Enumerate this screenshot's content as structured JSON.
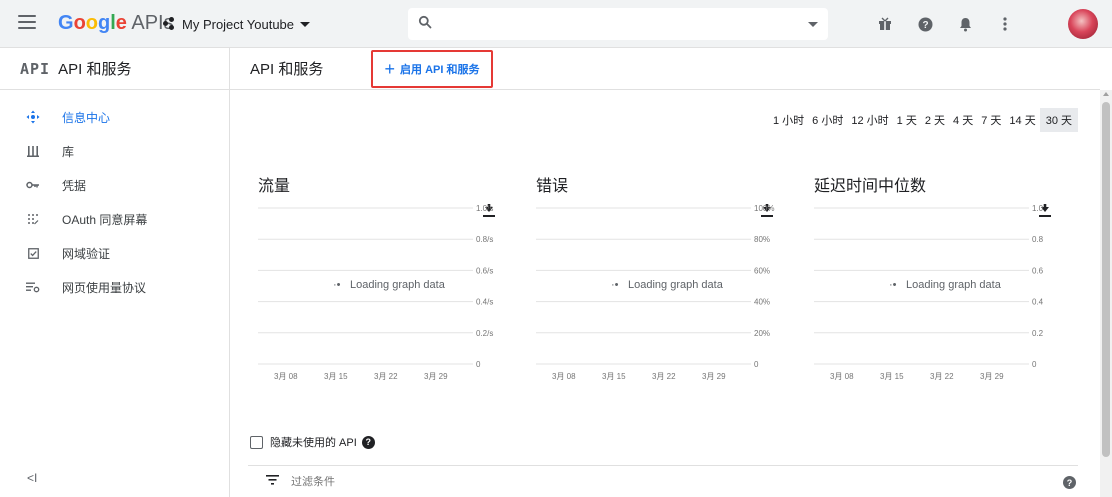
{
  "topbar": {
    "brand_google": "Google",
    "brand_suffix": " APIs",
    "project_name": "My Project Youtube",
    "search_value": "",
    "icons": [
      "gift-icon",
      "help-icon",
      "bell-icon",
      "more-vert-icon"
    ]
  },
  "colors": {
    "google_blue": "#4285F4",
    "google_red": "#EA4335",
    "google_yellow": "#FBBC05",
    "google_green": "#34A853",
    "accent": "#1a73e8",
    "highlight_border": "#e53935"
  },
  "sidebar": {
    "logo": "API",
    "title": "API 和服务",
    "items": [
      {
        "label": "信息中心",
        "icon": "dashboard-icon",
        "active": true
      },
      {
        "label": "库",
        "icon": "library-icon",
        "active": false
      },
      {
        "label": "凭据",
        "icon": "key-icon",
        "active": false
      },
      {
        "label": "OAuth 同意屏幕",
        "icon": "consent-icon",
        "active": false
      },
      {
        "label": "网域验证",
        "icon": "checkbox-icon",
        "active": false
      },
      {
        "label": "网页使用量协议",
        "icon": "settings-list-icon",
        "active": false
      }
    ],
    "collapse_label": "<I"
  },
  "main": {
    "title": "API 和服务",
    "enable_label": "启用 API 和服务",
    "time_ranges": [
      "1 小时",
      "6 小时",
      "12 小时",
      "1 天",
      "2 天",
      "4 天",
      "7 天",
      "14 天",
      "30 天"
    ],
    "selected_range": "30 天",
    "hide_unused_label": "隐藏未使用的 API",
    "filter_placeholder": "过滤条件"
  },
  "chart_data": [
    {
      "type": "line",
      "title": "流量",
      "loading_text": "Loading graph data",
      "y_ticks": [
        "1.0/s",
        "0.8/s",
        "0.6/s",
        "0.4/s",
        "0.2/s",
        "0"
      ],
      "x_ticks": [
        "3月 08",
        "3月 15",
        "3月 22",
        "3月 29"
      ]
    },
    {
      "type": "line",
      "title": "错误",
      "loading_text": "Loading graph data",
      "y_ticks": [
        "100%",
        "80%",
        "60%",
        "40%",
        "20%",
        "0"
      ],
      "x_ticks": [
        "3月 08",
        "3月 15",
        "3月 22",
        "3月 29"
      ]
    },
    {
      "type": "line",
      "title": "延迟时间中位数",
      "loading_text": "Loading graph data",
      "y_ticks": [
        "1.0",
        "0.8",
        "0.6",
        "0.4",
        "0.2",
        "0"
      ],
      "x_ticks": [
        "3月 08",
        "3月 15",
        "3月 22",
        "3月 29"
      ]
    }
  ]
}
